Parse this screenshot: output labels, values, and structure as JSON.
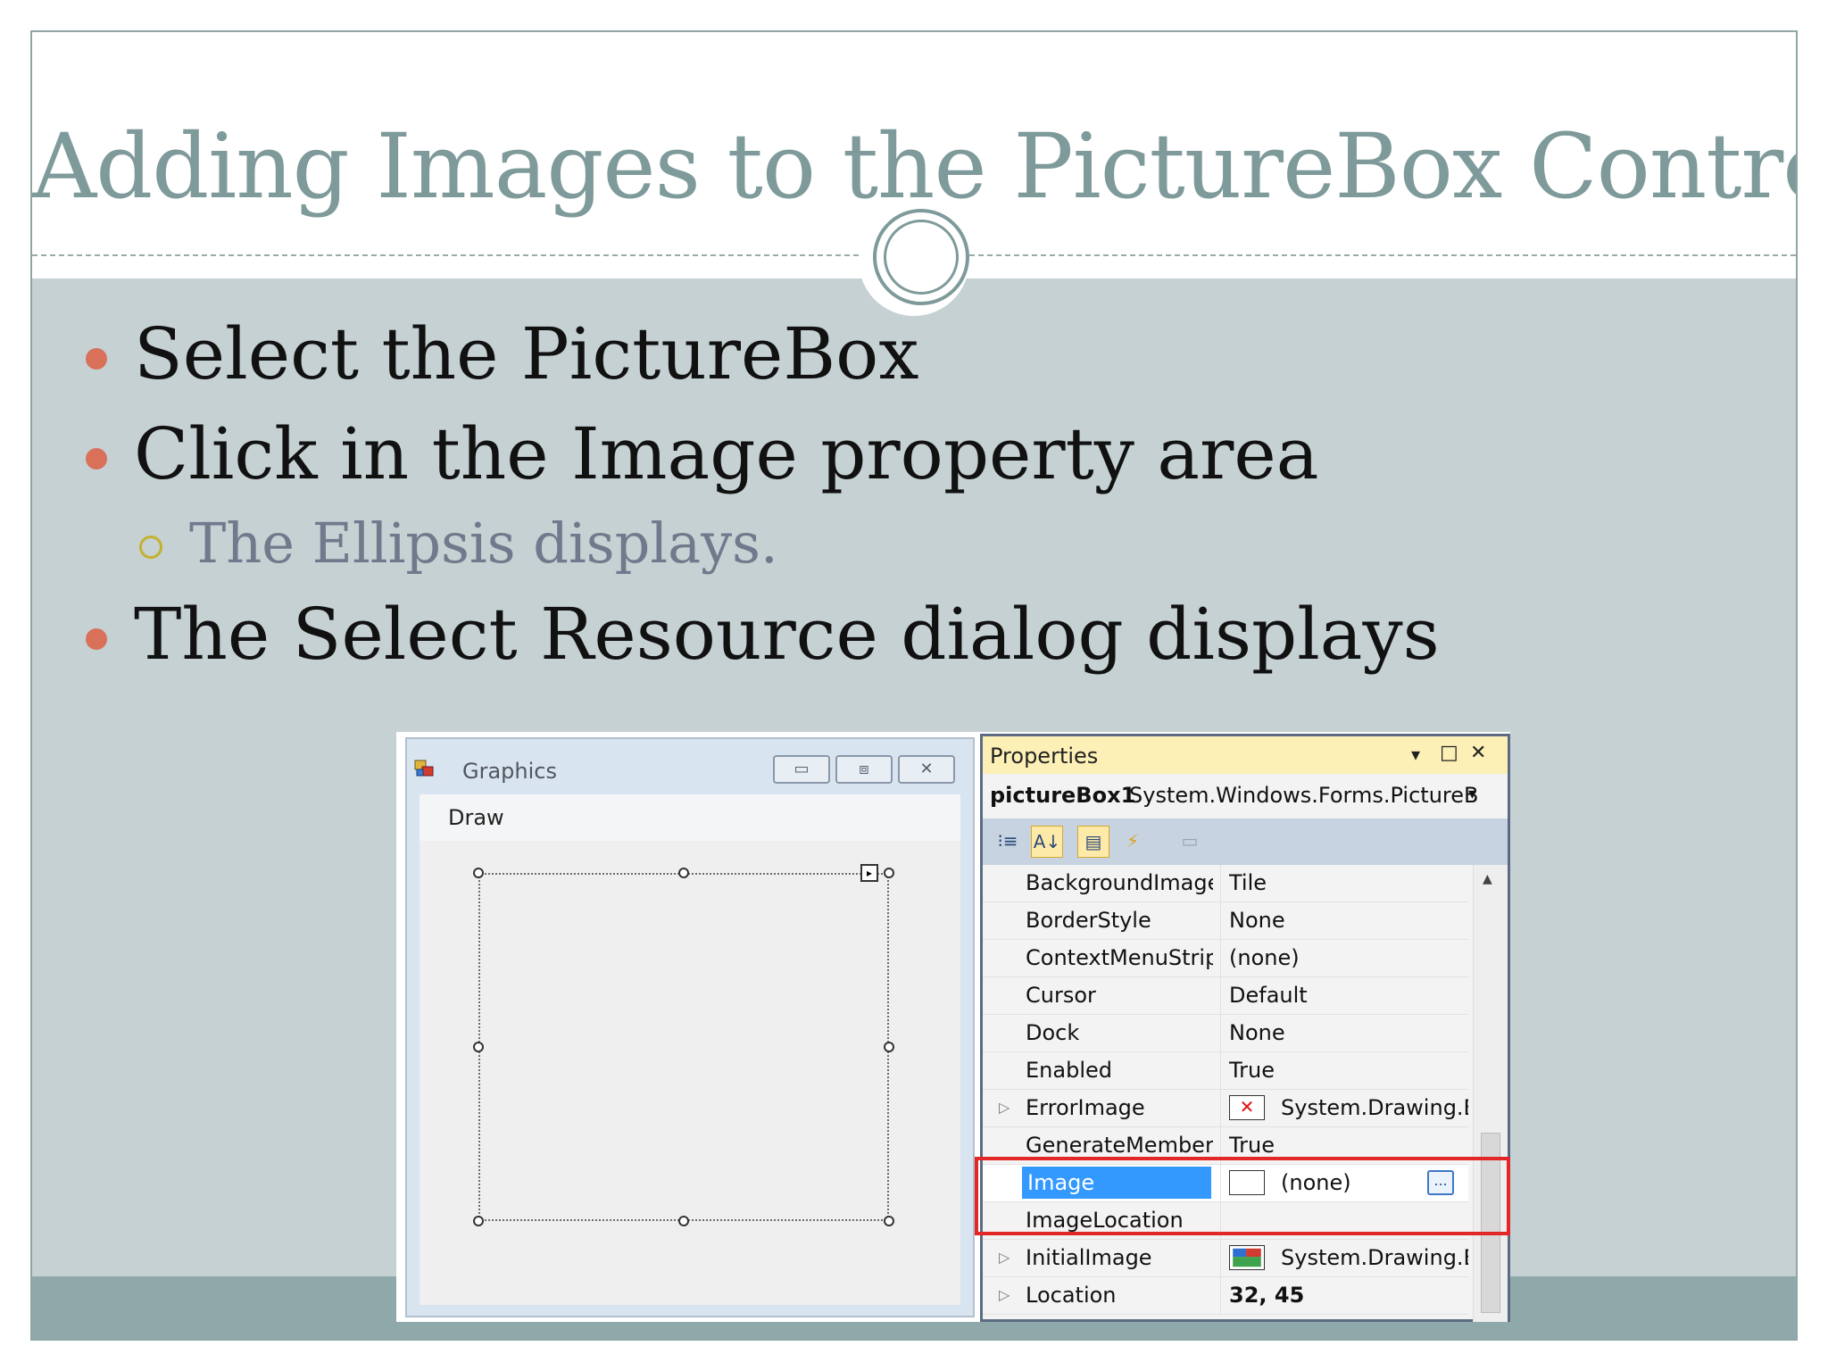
{
  "slide": {
    "title": "Adding Images to the PictureBox Control",
    "bullets": [
      "Select the PictureBox",
      "Click in the Image property area",
      "The Select Resource dialog displays"
    ],
    "sub_bullet": "The Ellipsis displays.",
    "colors": {
      "title": "#7f9a9a",
      "bullet_dot": "#d9715a",
      "sub_dot": "#c4b22e",
      "highlight_box": "#e32626"
    }
  },
  "form_window": {
    "title": "Graphics",
    "icons": {
      "app": "graphics-app-icon",
      "minimize": "minimize-icon",
      "maximize": "maximize-icon",
      "close": "close-icon"
    },
    "menu": [
      "Draw"
    ],
    "buttons": {
      "minimize": "▭",
      "maximize": "⧈",
      "close": "✕"
    },
    "smart_tag": "▸"
  },
  "properties_panel": {
    "title": "Properties",
    "title_controls": [
      "▾",
      "□",
      "✕"
    ],
    "object_name": "pictureBox1",
    "object_type": "System.Windows.Forms.PictureB",
    "dropdown": "▾",
    "toolbar_icons": [
      "categorized-icon",
      "alphabetical-icon",
      "properties-icon",
      "events-icon",
      "property-pages-icon"
    ],
    "toolbar_glyphs": [
      "⁝≡",
      "A↓",
      "▤",
      "⚡",
      "▭"
    ],
    "scroll_up": "▲",
    "rows": [
      {
        "name": "BackgroundImageL",
        "value": "Tile"
      },
      {
        "name": "BorderStyle",
        "value": "None"
      },
      {
        "name": "ContextMenuStrip",
        "value": "(none)"
      },
      {
        "name": "Cursor",
        "value": "Default"
      },
      {
        "name": "Dock",
        "value": "None"
      },
      {
        "name": "Enabled",
        "value": "True"
      },
      {
        "name": "ErrorImage",
        "value": "System.Drawing.B",
        "expand": "▷",
        "swatch": "✕"
      },
      {
        "name": "GenerateMember",
        "value": "True"
      },
      {
        "name": "Image",
        "value": "(none)",
        "selected": true,
        "ellipsis": "..."
      },
      {
        "name": "ImageLocation",
        "value": ""
      },
      {
        "name": "InitialImage",
        "value": "System.Drawing.B",
        "expand": "▷"
      },
      {
        "name": "Location",
        "value": "32, 45",
        "expand": "▷"
      }
    ]
  }
}
